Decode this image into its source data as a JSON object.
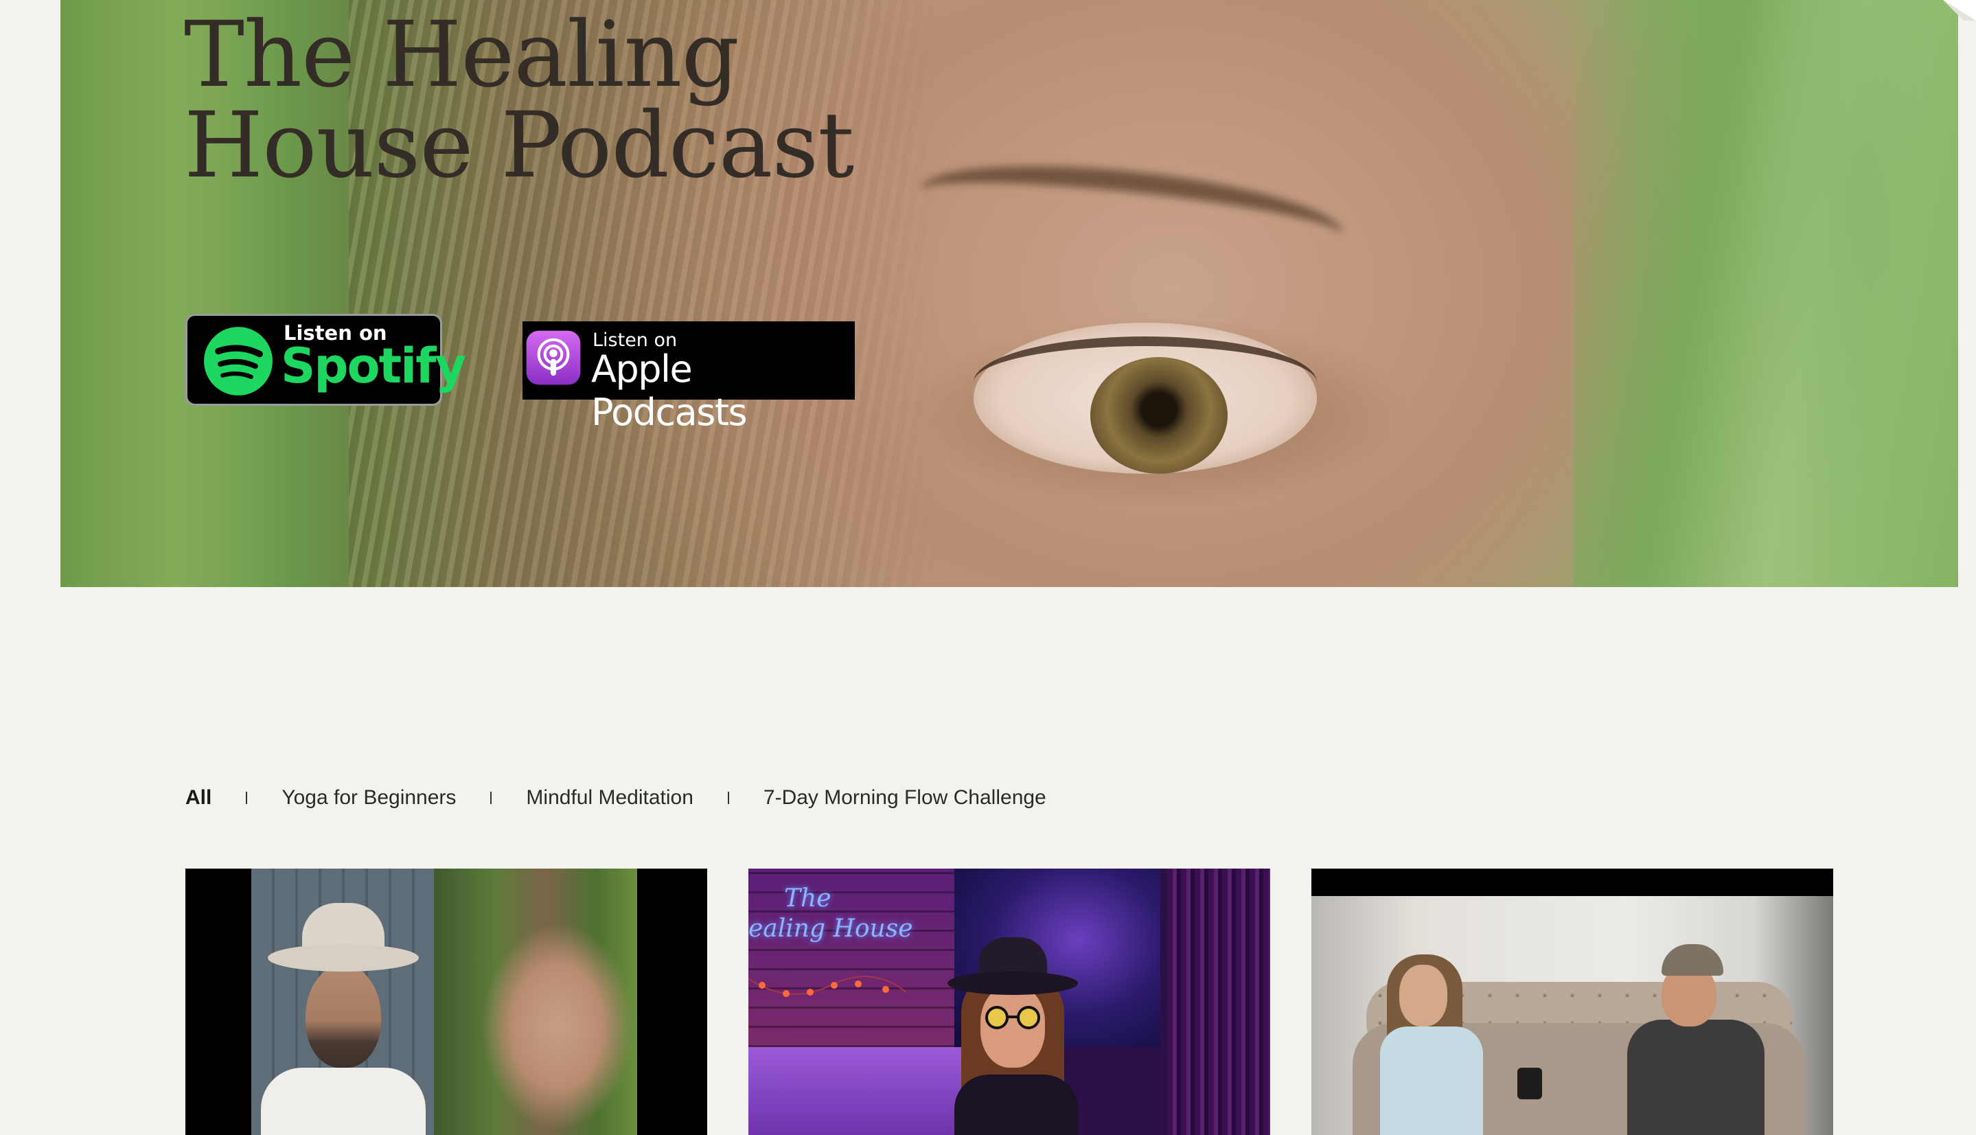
{
  "hero": {
    "title_line1": "The Healing",
    "title_line2": "House Podcast"
  },
  "badges": {
    "spotify": {
      "small": "Listen on",
      "big": "Spotify",
      "brand_color": "#1ed760"
    },
    "apple": {
      "small": "Listen on",
      "big": "Apple Podcasts",
      "brand_color": "#8e44ad"
    }
  },
  "filters": {
    "items": [
      {
        "label": "All",
        "active": true
      },
      {
        "label": "Yoga for Beginners",
        "active": false
      },
      {
        "label": "Mindful Meditation",
        "active": false
      },
      {
        "label": "7-Day Morning Flow Challenge",
        "active": false
      }
    ]
  },
  "cards": {
    "card2_sign_line1": "The",
    "card2_sign_line2": "ealing House"
  },
  "colors": {
    "page_background": "#f3f2ee",
    "title_color": "#332c27"
  }
}
